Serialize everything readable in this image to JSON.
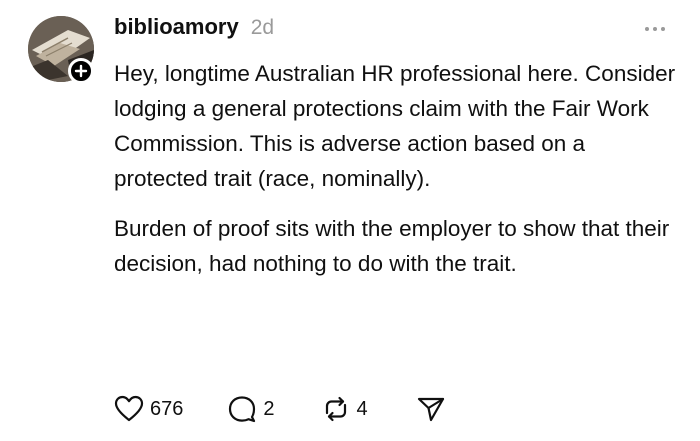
{
  "post": {
    "author": {
      "username": "biblioamory",
      "avatar_icon": "avatar-image",
      "follow_icon": "plus-icon"
    },
    "timestamp": "2d",
    "more_icon": "more-dots-icon",
    "paragraphs": [
      "Hey, longtime Australian HR professional here. Consider lodging a general protections claim with the Fair Work Commission. This is adverse action based on a protected trait (race, nominally).",
      "Burden of proof sits with the employer to show that their decision, had nothing to do with the trait."
    ],
    "actions": {
      "likes": "676",
      "replies": "2",
      "reposts": "4"
    }
  }
}
